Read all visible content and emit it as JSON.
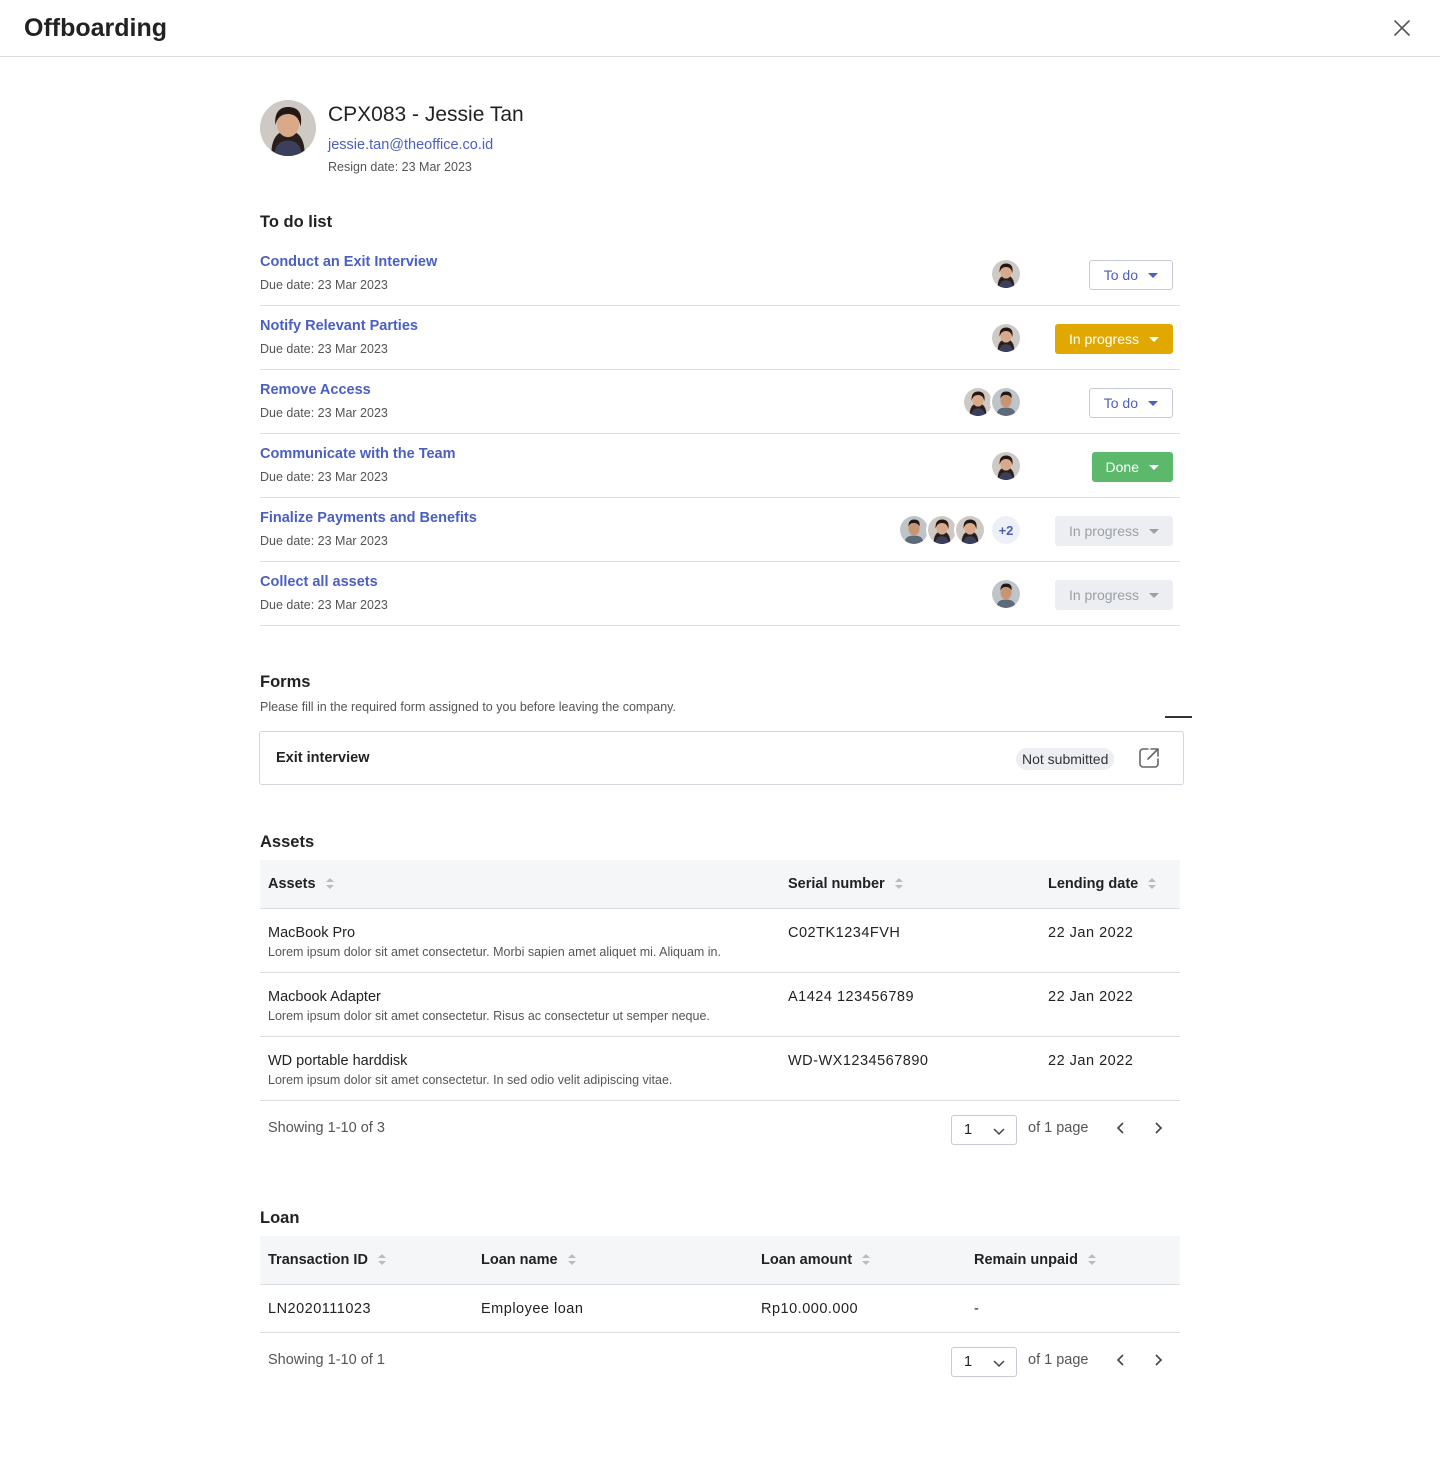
{
  "header": {
    "title": "Offboarding"
  },
  "employee": {
    "name": "CPX083 - Jessie Tan",
    "email": "jessie.tan@theoffice.co.id",
    "resign_date": "Resign date: 23 Mar 2023"
  },
  "todo": {
    "title": "To do list",
    "items": [
      {
        "title": "Conduct an Exit Interview",
        "due": "Due date: 23 Mar 2023",
        "status": "To do",
        "status_style": "todo",
        "assignees": [
          "woman"
        ]
      },
      {
        "title": "Notify Relevant Parties",
        "due": "Due date: 23 Mar 2023",
        "status": "In progress",
        "status_style": "progress",
        "assignees": [
          "woman"
        ]
      },
      {
        "title": "Remove Access",
        "due": "Due date: 23 Mar 2023",
        "status": "To do",
        "status_style": "todo",
        "assignees": [
          "woman",
          "man"
        ]
      },
      {
        "title": "Communicate with the Team",
        "due": "Due date: 23 Mar 2023",
        "status": "Done",
        "status_style": "done",
        "assignees": [
          "woman"
        ]
      },
      {
        "title": "Finalize Payments and Benefits",
        "due": "Due date: 23 Mar 2023",
        "status": "In progress",
        "status_style": "disabled",
        "assignees": [
          "man",
          "woman",
          "woman"
        ],
        "extra": "+2"
      },
      {
        "title": "Collect all assets",
        "due": "Due date: 23 Mar 2023",
        "status": "In progress",
        "status_style": "disabled",
        "assignees": [
          "man"
        ]
      }
    ]
  },
  "forms": {
    "title": "Forms",
    "description": "Please fill in the required form assigned to you before leaving the company.",
    "items": [
      {
        "name": "Exit interview",
        "status": "Not submitted"
      }
    ]
  },
  "assets": {
    "title": "Assets",
    "columns": [
      "Assets",
      "Serial number",
      "Lending date"
    ],
    "rows": [
      {
        "name": "MacBook Pro",
        "desc": "Lorem ipsum dolor sit amet consectetur. Morbi sapien amet aliquet mi. Aliquam in.",
        "serial": "C02TK1234FVH",
        "date": "22 Jan 2022"
      },
      {
        "name": "Macbook Adapter",
        "desc": "Lorem ipsum dolor sit amet consectetur. Risus ac consectetur ut semper neque.",
        "serial": "A1424 123456789",
        "date": "22 Jan 2022"
      },
      {
        "name": "WD portable harddisk",
        "desc": "Lorem ipsum dolor sit amet consectetur. In sed odio velit adipiscing vitae.",
        "serial": "WD-WX1234567890",
        "date": "22 Jan 2022"
      }
    ],
    "pagination": {
      "showing": "Showing 1-10 of 3",
      "page": "1",
      "of_page": "of 1 page"
    }
  },
  "loan": {
    "title": "Loan",
    "columns": [
      "Transaction ID",
      "Loan name",
      "Loan amount",
      "Remain unpaid"
    ],
    "rows": [
      {
        "id": "LN2020111023",
        "name": "Employee loan",
        "amount": "Rp10.000.000",
        "unpaid": "-"
      }
    ],
    "pagination": {
      "showing": "Showing 1-10 of 1",
      "page": "1",
      "of_page": "of 1 page"
    }
  },
  "icons": {
    "close": "close-icon",
    "open_form": "external-link-icon",
    "sort": "sort-icon",
    "prev": "chevron-left-icon",
    "next": "chevron-right-icon",
    "dropdown": "chevron-down-icon"
  },
  "colors": {
    "link": "#4a5fc1",
    "in_progress": "#e0a800",
    "done": "#5cb96c",
    "disabled_bg": "#eceef1",
    "table_header_bg": "#f5f6f8"
  }
}
